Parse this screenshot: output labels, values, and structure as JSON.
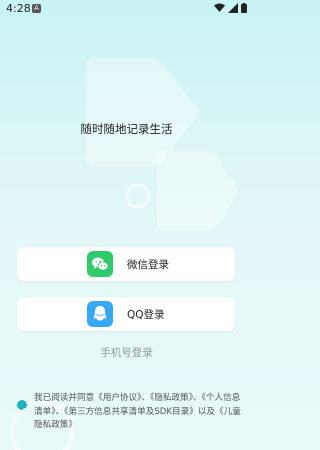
{
  "status": {
    "time": "4:28",
    "notif_glyph": "A"
  },
  "tagline": "随时随地记录生活",
  "buttons": [
    {
      "label": "微信登录",
      "icon": "wechat-icon"
    },
    {
      "label": "QQ登录",
      "icon": "qq-icon"
    }
  ],
  "phone_login": "手机号登录",
  "agreement": {
    "checked": true,
    "prefix": "我已阅读并同意",
    "link1": "《用户协议》",
    "sep1": "、",
    "link2": "《隐私政策》",
    "sep2": "、",
    "link3": "《个人信息清单》",
    "sep3": "、",
    "link4": "《第三方信息共享清单及SDK目录》",
    "sep4": "以及",
    "link5": "《儿童隐私政策》"
  },
  "colors": {
    "wechat": "#2ecb6a",
    "qq": "#35a9f3",
    "accent": "#1fb5b9"
  }
}
